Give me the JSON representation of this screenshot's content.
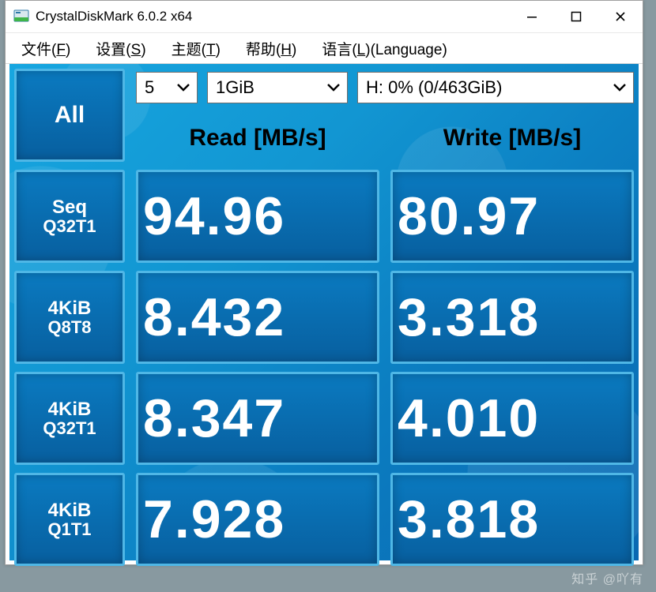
{
  "window": {
    "title": "CrystalDiskMark 6.0.2 x64"
  },
  "menu": {
    "file": {
      "label": "文件",
      "accel": "F"
    },
    "settings": {
      "label": "设置",
      "accel": "S"
    },
    "theme": {
      "label": "主题",
      "accel": "T"
    },
    "help": {
      "label": "帮助",
      "accel": "H"
    },
    "lang": {
      "label": "语言",
      "accel": "L",
      "suffix": "(Language)"
    }
  },
  "controls": {
    "count": {
      "value": "5"
    },
    "size": {
      "value": "1GiB"
    },
    "drive": {
      "value": "H: 0% (0/463GiB)"
    }
  },
  "headers": {
    "read": "Read [MB/s]",
    "write": "Write [MB/s]"
  },
  "buttons": {
    "all": "All",
    "tests": [
      {
        "line1": "Seq",
        "line2": "Q32T1"
      },
      {
        "line1": "4KiB",
        "line2": "Q8T8"
      },
      {
        "line1": "4KiB",
        "line2": "Q32T1"
      },
      {
        "line1": "4KiB",
        "line2": "Q1T1"
      }
    ]
  },
  "results": {
    "rows": [
      {
        "read": "94.96",
        "write": "80.97"
      },
      {
        "read": "8.432",
        "write": "3.318"
      },
      {
        "read": "8.347",
        "write": "4.010"
      },
      {
        "read": "7.928",
        "write": "3.818"
      }
    ]
  },
  "watermark": "知乎 @吖有",
  "chart_data": {
    "type": "table",
    "title": "CrystalDiskMark 6.0.2 x64 — H: 0% (0/463GiB), 5×1GiB",
    "columns": [
      "Test",
      "Read [MB/s]",
      "Write [MB/s]"
    ],
    "rows": [
      [
        "Seq Q32T1",
        94.96,
        80.97
      ],
      [
        "4KiB Q8T8",
        8.432,
        3.318
      ],
      [
        "4KiB Q32T1",
        8.347,
        4.01
      ],
      [
        "4KiB Q1T1",
        7.928,
        3.818
      ]
    ]
  }
}
